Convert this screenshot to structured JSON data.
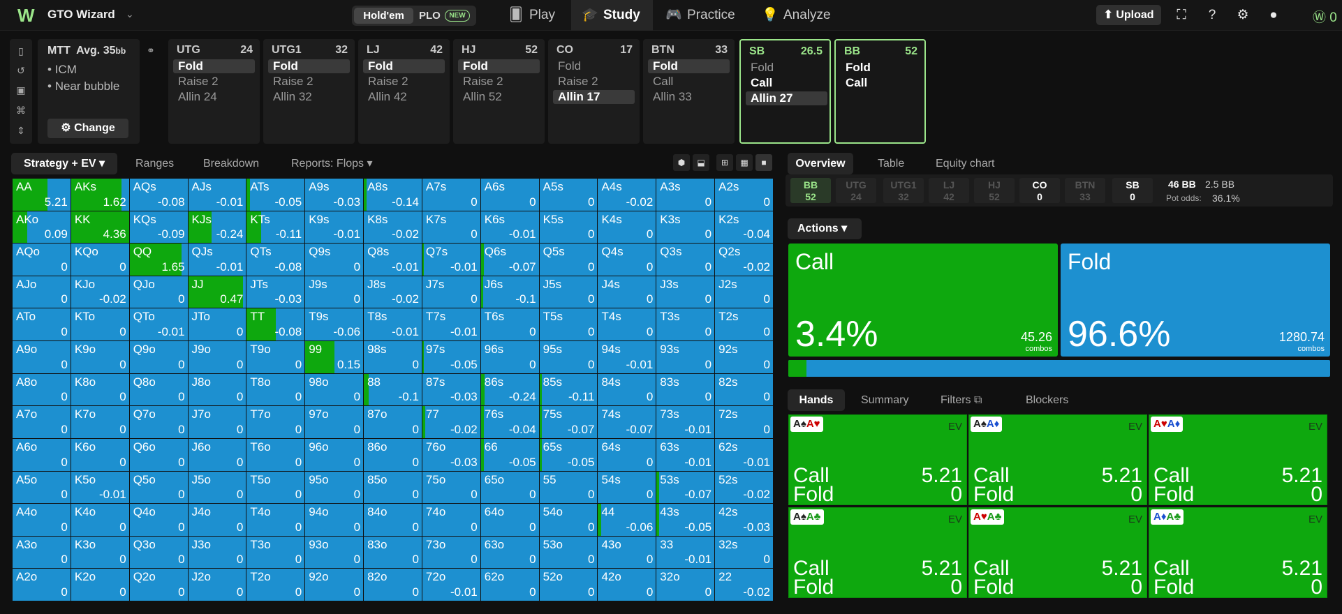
{
  "app": {
    "name": "GTO Wizard",
    "modes": [
      "Hold'em",
      "PLO"
    ],
    "new_badge": "NEW"
  },
  "nav": [
    "Play",
    "Study",
    "Practice",
    "Analyze"
  ],
  "top": {
    "upload": "Upload",
    "coins": "0"
  },
  "mtt": {
    "title": "MTT",
    "avg": "Avg. 35",
    "avg_unit": "bb",
    "items": [
      "ICM",
      "Near bubble"
    ],
    "change": "Change"
  },
  "positions": [
    {
      "name": "UTG",
      "stack": "24",
      "options": [
        "Fold",
        "Raise 2",
        "Allin 24"
      ],
      "hl": 0
    },
    {
      "name": "UTG1",
      "stack": "32",
      "options": [
        "Fold",
        "Raise 2",
        "Allin 32"
      ],
      "hl": 0
    },
    {
      "name": "LJ",
      "stack": "42",
      "options": [
        "Fold",
        "Raise 2",
        "Allin 42"
      ],
      "hl": 0
    },
    {
      "name": "HJ",
      "stack": "52",
      "options": [
        "Fold",
        "Raise 2",
        "Allin 52"
      ],
      "hl": 0
    },
    {
      "name": "CO",
      "stack": "17",
      "options": [
        "Fold",
        "Raise 2",
        "Allin 17"
      ],
      "hl": 2
    },
    {
      "name": "BTN",
      "stack": "33",
      "options": [
        "Fold",
        "Call",
        "Allin 33"
      ],
      "hl": 0
    },
    {
      "name": "SB",
      "stack": "26.5",
      "options": [
        "Fold",
        "Call",
        "Allin 27"
      ],
      "hl": 2
    },
    {
      "name": "BB",
      "stack": "52",
      "options": [
        "Fold",
        "Call"
      ],
      "hl": -1
    }
  ],
  "left_tabs": [
    "Strategy + EV",
    "Ranges",
    "Breakdown",
    "Reports: Flops"
  ],
  "right_tabs": [
    "Overview",
    "Table",
    "Equity chart"
  ],
  "summary": {
    "players": [
      [
        "BB",
        "52"
      ],
      [
        "UTG",
        "24"
      ],
      [
        "UTG1",
        "32"
      ],
      [
        "LJ",
        "42"
      ],
      [
        "HJ",
        "52"
      ],
      [
        "CO",
        "0"
      ],
      [
        "BTN",
        "33"
      ],
      [
        "SB",
        "0"
      ]
    ],
    "pot": "46 BB",
    "bet": "2.5 BB",
    "pot_odds_label": "Pot odds:",
    "pot_odds": "36.1%"
  },
  "actions_label": "Actions",
  "actions": [
    {
      "name": "Call",
      "pct": "3.4%",
      "combos": "45.26",
      "combos_label": "combos",
      "color": "#0ea80e"
    },
    {
      "name": "Fold",
      "pct": "96.6%",
      "combos": "1280.74",
      "combos_label": "combos",
      "color": "#1d90d0"
    }
  ],
  "call_freq": 0.034,
  "hands_tabs": [
    "Hands",
    "Summary",
    "Filters",
    "Blockers"
  ],
  "hand_cards": [
    {
      "cards": [
        [
          "A",
          "♠",
          "#222"
        ],
        [
          "A",
          "♥",
          "#c00"
        ]
      ],
      "call": "5.21",
      "fold": "0"
    },
    {
      "cards": [
        [
          "A",
          "♠",
          "#222"
        ],
        [
          "A",
          "♦",
          "#1a4fd0"
        ]
      ],
      "call": "5.21",
      "fold": "0"
    },
    {
      "cards": [
        [
          "A",
          "♥",
          "#c00"
        ],
        [
          "A",
          "♦",
          "#1a4fd0"
        ]
      ],
      "call": "5.21",
      "fold": "0"
    },
    {
      "cards": [
        [
          "A",
          "♠",
          "#222"
        ],
        [
          "A",
          "♣",
          "#1a9a1a"
        ]
      ],
      "call": "5.21",
      "fold": "0"
    },
    {
      "cards": [
        [
          "A",
          "♥",
          "#c00"
        ],
        [
          "A",
          "♣",
          "#1a9a1a"
        ]
      ],
      "call": "5.21",
      "fold": "0"
    },
    {
      "cards": [
        [
          "A",
          "♦",
          "#1a4fd0"
        ],
        [
          "A",
          "♣",
          "#1a9a1a"
        ]
      ],
      "call": "5.21",
      "fold": "0"
    }
  ],
  "hand_labels": {
    "ev": "EV",
    "call": "Call",
    "fold": "Fold"
  },
  "colors": {
    "call": "#0ea80e",
    "fold": "#1d90d0",
    "accent": "#9be58a"
  },
  "matrix": [
    [
      [
        "AA",
        "5.21",
        0.6
      ],
      [
        "AKs",
        "1.62",
        0.87
      ],
      [
        "AQs",
        "-0.08",
        0
      ],
      [
        "AJs",
        "-0.01",
        0
      ],
      [
        "ATs",
        "-0.05",
        0.05
      ],
      [
        "A9s",
        "-0.03",
        0
      ],
      [
        "A8s",
        "-0.14",
        0.05
      ],
      [
        "A7s",
        "0",
        0
      ],
      [
        "A6s",
        "0",
        0
      ],
      [
        "A5s",
        "0",
        0
      ],
      [
        "A4s",
        "-0.02",
        0
      ],
      [
        "A3s",
        "0",
        0
      ],
      [
        "A2s",
        "0",
        0
      ]
    ],
    [
      [
        "AKo",
        "0.09",
        0.25
      ],
      [
        "KK",
        "4.36",
        1
      ],
      [
        "KQs",
        "-0.09",
        0
      ],
      [
        "KJs",
        "-0.24",
        0.4
      ],
      [
        "KTs",
        "-0.11",
        0.25
      ],
      [
        "K9s",
        "-0.01",
        0
      ],
      [
        "K8s",
        "-0.02",
        0
      ],
      [
        "K7s",
        "0",
        0
      ],
      [
        "K6s",
        "-0.01",
        0
      ],
      [
        "K5s",
        "0",
        0
      ],
      [
        "K4s",
        "0",
        0
      ],
      [
        "K3s",
        "0",
        0
      ],
      [
        "K2s",
        "-0.04",
        0
      ]
    ],
    [
      [
        "AQo",
        "0",
        0
      ],
      [
        "KQo",
        "0",
        0
      ],
      [
        "QQ",
        "1.65",
        0.9
      ],
      [
        "QJs",
        "-0.01",
        0
      ],
      [
        "QTs",
        "-0.08",
        0
      ],
      [
        "Q9s",
        "0",
        0
      ],
      [
        "Q8s",
        "-0.01",
        0
      ],
      [
        "Q7s",
        "-0.01",
        0.03
      ],
      [
        "Q6s",
        "-0.07",
        0.05
      ],
      [
        "Q5s",
        "0",
        0
      ],
      [
        "Q4s",
        "0",
        0
      ],
      [
        "Q3s",
        "0",
        0
      ],
      [
        "Q2s",
        "-0.02",
        0
      ]
    ],
    [
      [
        "AJo",
        "0",
        0
      ],
      [
        "KJo",
        "-0.02",
        0
      ],
      [
        "QJo",
        "0",
        0
      ],
      [
        "JJ",
        "0.47",
        0.95
      ],
      [
        "JTs",
        "-0.03",
        0
      ],
      [
        "J9s",
        "0",
        0
      ],
      [
        "J8s",
        "-0.02",
        0
      ],
      [
        "J7s",
        "0",
        0
      ],
      [
        "J6s",
        "-0.1",
        0.04
      ],
      [
        "J5s",
        "0",
        0
      ],
      [
        "J4s",
        "0",
        0
      ],
      [
        "J3s",
        "0",
        0
      ],
      [
        "J2s",
        "0",
        0
      ]
    ],
    [
      [
        "ATo",
        "0",
        0
      ],
      [
        "KTo",
        "0",
        0
      ],
      [
        "QTo",
        "-0.01",
        0
      ],
      [
        "JTo",
        "0",
        0
      ],
      [
        "TT",
        "-0.08",
        0.5
      ],
      [
        "T9s",
        "-0.06",
        0
      ],
      [
        "T8s",
        "-0.01",
        0
      ],
      [
        "T7s",
        "-0.01",
        0
      ],
      [
        "T6s",
        "0",
        0
      ],
      [
        "T5s",
        "0",
        0
      ],
      [
        "T4s",
        "0",
        0
      ],
      [
        "T3s",
        "0",
        0
      ],
      [
        "T2s",
        "0",
        0
      ]
    ],
    [
      [
        "A9o",
        "0",
        0
      ],
      [
        "K9o",
        "0",
        0
      ],
      [
        "Q9o",
        "0",
        0
      ],
      [
        "J9o",
        "0",
        0
      ],
      [
        "T9o",
        "0",
        0
      ],
      [
        "99",
        "0.15",
        0.5
      ],
      [
        "98s",
        "0",
        0
      ],
      [
        "97s",
        "-0.05",
        0.03
      ],
      [
        "96s",
        "0",
        0
      ],
      [
        "95s",
        "0",
        0
      ],
      [
        "94s",
        "-0.01",
        0
      ],
      [
        "93s",
        "0",
        0
      ],
      [
        "92s",
        "0",
        0
      ]
    ],
    [
      [
        "A8o",
        "0",
        0
      ],
      [
        "K8o",
        "0",
        0
      ],
      [
        "Q8o",
        "0",
        0
      ],
      [
        "J8o",
        "0",
        0
      ],
      [
        "T8o",
        "0",
        0
      ],
      [
        "98o",
        "0",
        0
      ],
      [
        "88",
        "-0.1",
        0.08
      ],
      [
        "87s",
        "-0.03",
        0
      ],
      [
        "86s",
        "-0.24",
        0.06
      ],
      [
        "85s",
        "-0.11",
        0.04
      ],
      [
        "84s",
        "0",
        0
      ],
      [
        "83s",
        "0",
        0
      ],
      [
        "82s",
        "0",
        0
      ]
    ],
    [
      [
        "A7o",
        "0",
        0
      ],
      [
        "K7o",
        "0",
        0
      ],
      [
        "Q7o",
        "0",
        0
      ],
      [
        "J7o",
        "0",
        0
      ],
      [
        "T7o",
        "0",
        0
      ],
      [
        "97o",
        "0",
        0
      ],
      [
        "87o",
        "0",
        0
      ],
      [
        "77",
        "-0.02",
        0.05
      ],
      [
        "76s",
        "-0.04",
        0.05
      ],
      [
        "75s",
        "-0.07",
        0.04
      ],
      [
        "74s",
        "-0.07",
        0
      ],
      [
        "73s",
        "-0.01",
        0
      ],
      [
        "72s",
        "0",
        0
      ]
    ],
    [
      [
        "A6o",
        "0",
        0
      ],
      [
        "K6o",
        "0",
        0
      ],
      [
        "Q6o",
        "0",
        0
      ],
      [
        "J6o",
        "0",
        0
      ],
      [
        "T6o",
        "0",
        0
      ],
      [
        "96o",
        "0",
        0
      ],
      [
        "86o",
        "0",
        0
      ],
      [
        "76o",
        "-0.03",
        0
      ],
      [
        "66",
        "-0.05",
        0.05
      ],
      [
        "65s",
        "-0.05",
        0.04
      ],
      [
        "64s",
        "0",
        0
      ],
      [
        "63s",
        "-0.01",
        0
      ],
      [
        "62s",
        "-0.01",
        0
      ]
    ],
    [
      [
        "A5o",
        "0",
        0
      ],
      [
        "K5o",
        "-0.01",
        0
      ],
      [
        "Q5o",
        "0",
        0
      ],
      [
        "J5o",
        "0",
        0
      ],
      [
        "T5o",
        "0",
        0
      ],
      [
        "95o",
        "0",
        0
      ],
      [
        "85o",
        "0",
        0
      ],
      [
        "75o",
        "0",
        0
      ],
      [
        "65o",
        "0",
        0
      ],
      [
        "55",
        "0",
        0
      ],
      [
        "54s",
        "0",
        0
      ],
      [
        "53s",
        "-0.07",
        0.05
      ],
      [
        "52s",
        "-0.02",
        0
      ]
    ],
    [
      [
        "A4o",
        "0",
        0
      ],
      [
        "K4o",
        "0",
        0
      ],
      [
        "Q4o",
        "0",
        0
      ],
      [
        "J4o",
        "0",
        0
      ],
      [
        "T4o",
        "0",
        0
      ],
      [
        "94o",
        "0",
        0
      ],
      [
        "84o",
        "0",
        0
      ],
      [
        "74o",
        "0",
        0
      ],
      [
        "64o",
        "0",
        0
      ],
      [
        "54o",
        "0",
        0
      ],
      [
        "44",
        "-0.06",
        0.05
      ],
      [
        "43s",
        "-0.05",
        0.05
      ],
      [
        "42s",
        "-0.03",
        0
      ]
    ],
    [
      [
        "A3o",
        "0",
        0
      ],
      [
        "K3o",
        "0",
        0
      ],
      [
        "Q3o",
        "0",
        0
      ],
      [
        "J3o",
        "0",
        0
      ],
      [
        "T3o",
        "0",
        0
      ],
      [
        "93o",
        "0",
        0
      ],
      [
        "83o",
        "0",
        0
      ],
      [
        "73o",
        "0",
        0
      ],
      [
        "63o",
        "0",
        0
      ],
      [
        "53o",
        "0",
        0
      ],
      [
        "43o",
        "0",
        0
      ],
      [
        "33",
        "-0.01",
        0
      ],
      [
        "32s",
        "0",
        0
      ]
    ],
    [
      [
        "A2o",
        "0",
        0
      ],
      [
        "K2o",
        "0",
        0
      ],
      [
        "Q2o",
        "0",
        0
      ],
      [
        "J2o",
        "0",
        0
      ],
      [
        "T2o",
        "0",
        0
      ],
      [
        "92o",
        "0",
        0
      ],
      [
        "82o",
        "0",
        0
      ],
      [
        "72o",
        "-0.01",
        0
      ],
      [
        "62o",
        "0",
        0
      ],
      [
        "52o",
        "0",
        0
      ],
      [
        "42o",
        "0",
        0
      ],
      [
        "32o",
        "0",
        0
      ],
      [
        "22",
        "-0.02",
        0
      ]
    ]
  ]
}
